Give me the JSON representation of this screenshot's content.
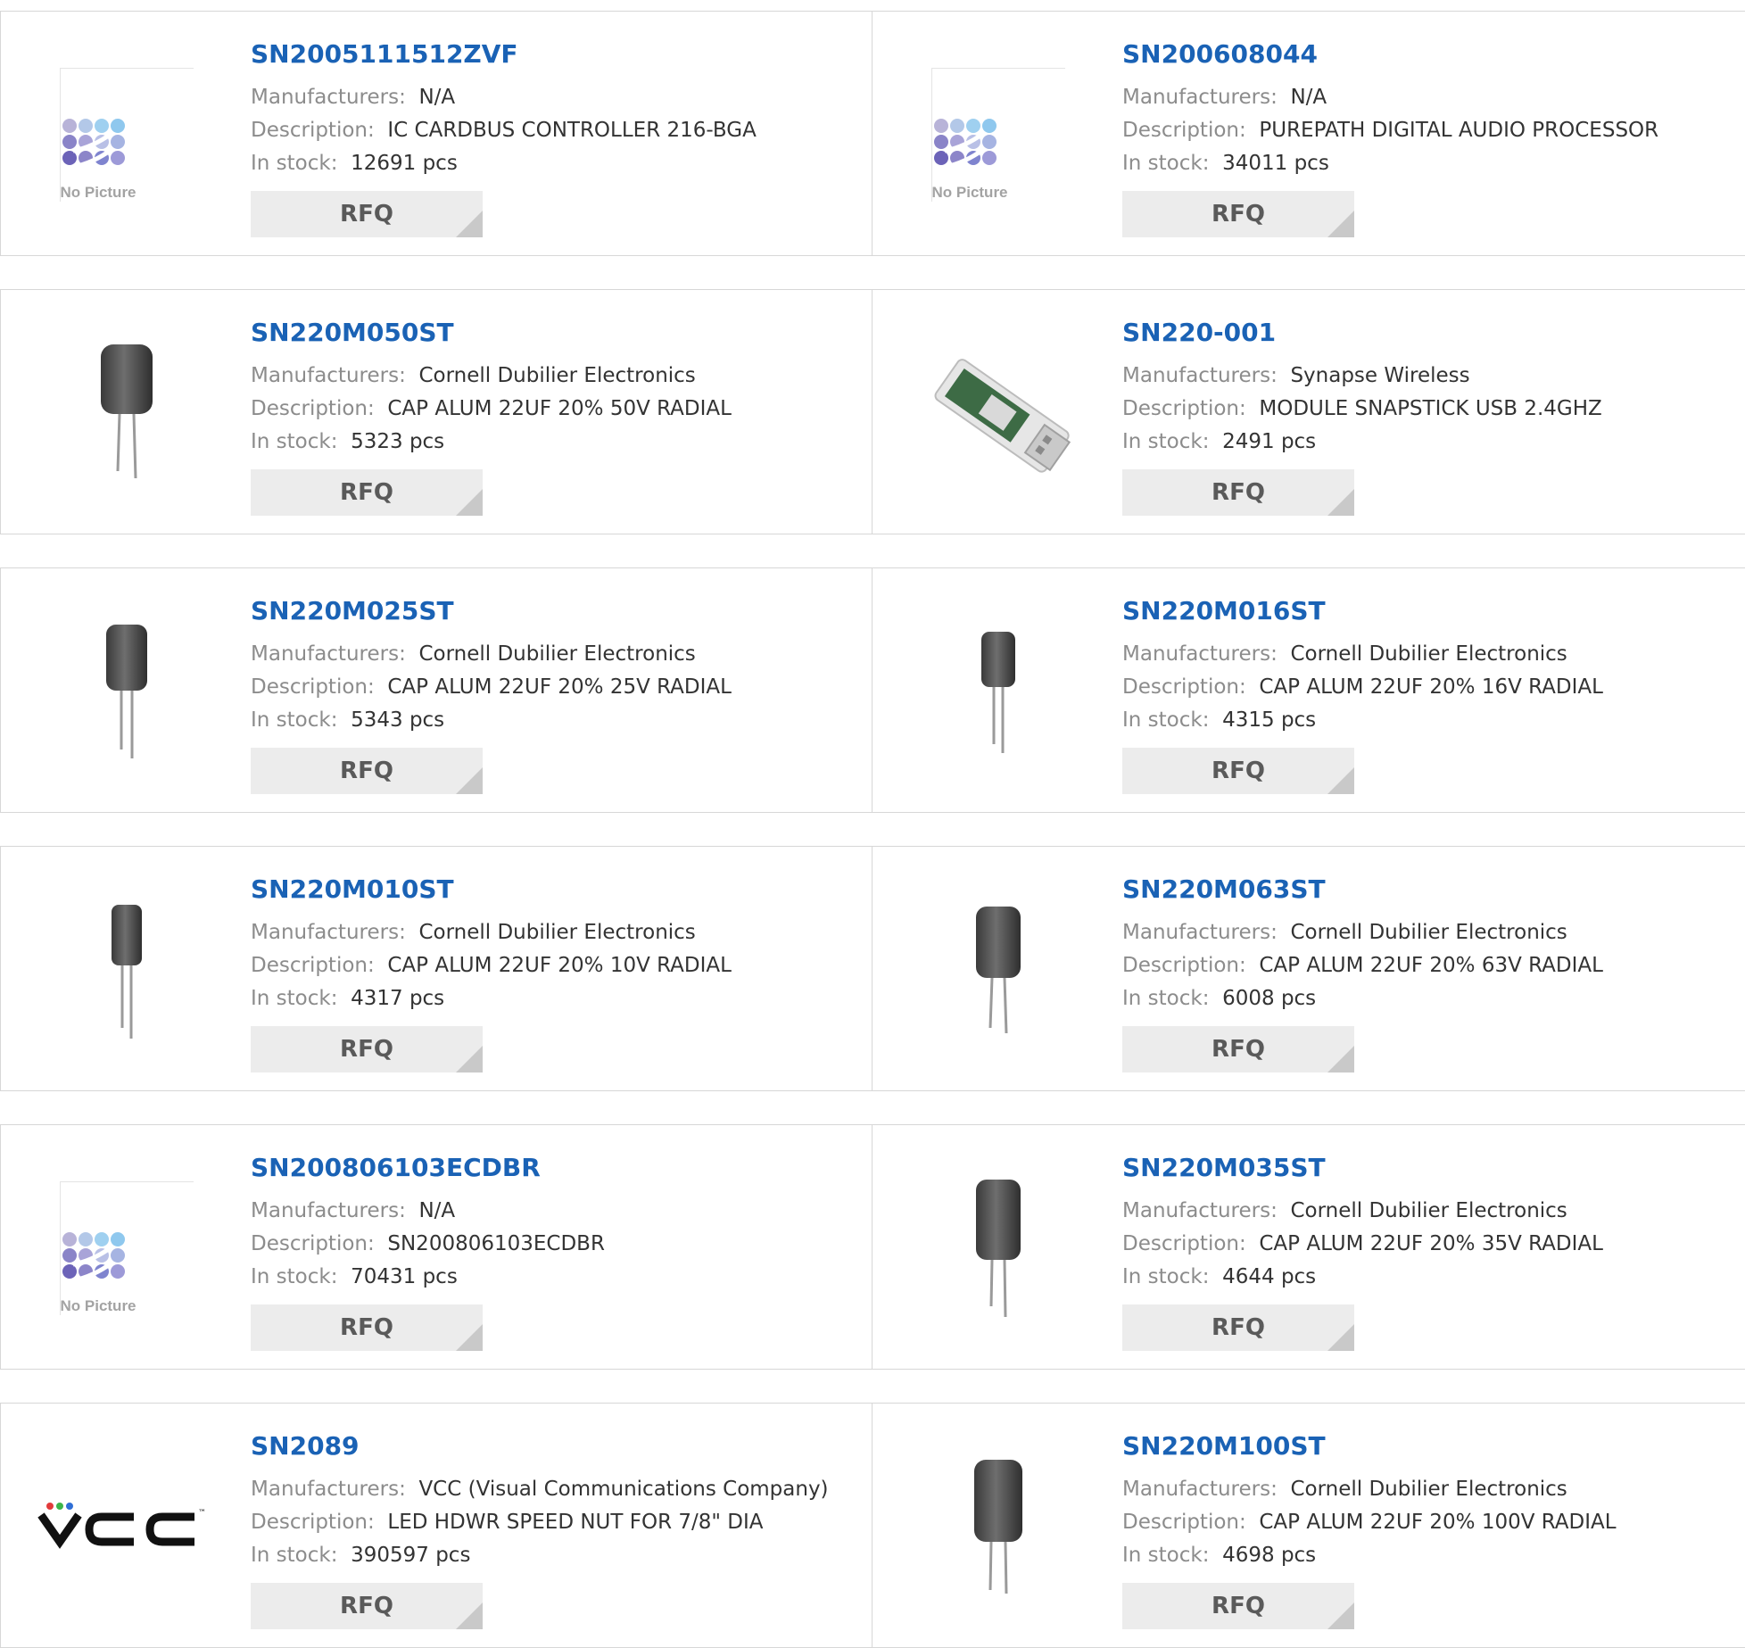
{
  "labels": {
    "manufacturers": "Manufacturers:",
    "description": "Description:",
    "in_stock": "In stock:",
    "rfq": "RFQ",
    "no_picture": "No Picture"
  },
  "products": [
    {
      "part": "SN2005111512ZVF",
      "manufacturer": "N/A",
      "description": "IC CARDBUS CONTROLLER 216-BGA",
      "stock": "12691 pcs",
      "image": "no-picture"
    },
    {
      "part": "SN200608044",
      "manufacturer": "N/A",
      "description": "PUREPATH DIGITAL AUDIO PROCESSOR",
      "stock": "34011 pcs",
      "image": "no-picture"
    },
    {
      "part": "SN220M050ST",
      "manufacturer": "Cornell Dubilier Electronics",
      "description": "CAP ALUM 22UF 20% 50V RADIAL",
      "stock": "5323 pcs",
      "image": "capacitor"
    },
    {
      "part": "SN220-001",
      "manufacturer": "Synapse Wireless",
      "description": "MODULE SNAPSTICK USB 2.4GHZ",
      "stock": "2491 pcs",
      "image": "usb-module"
    },
    {
      "part": "SN220M025ST",
      "manufacturer": "Cornell Dubilier Electronics",
      "description": "CAP ALUM 22UF 20% 25V RADIAL",
      "stock": "5343 pcs",
      "image": "capacitor"
    },
    {
      "part": "SN220M016ST",
      "manufacturer": "Cornell Dubilier Electronics",
      "description": "CAP ALUM 22UF 20% 16V RADIAL",
      "stock": "4315 pcs",
      "image": "capacitor"
    },
    {
      "part": "SN220M010ST",
      "manufacturer": "Cornell Dubilier Electronics",
      "description": "CAP ALUM 22UF 20% 10V RADIAL",
      "stock": "4317 pcs",
      "image": "capacitor"
    },
    {
      "part": "SN220M063ST",
      "manufacturer": "Cornell Dubilier Electronics",
      "description": "CAP ALUM 22UF 20% 63V RADIAL",
      "stock": "6008 pcs",
      "image": "capacitor"
    },
    {
      "part": "SN200806103ECDBR",
      "manufacturer": "N/A",
      "description": "SN200806103ECDBR",
      "stock": "70431 pcs",
      "image": "no-picture"
    },
    {
      "part": "SN220M035ST",
      "manufacturer": "Cornell Dubilier Electronics",
      "description": "CAP ALUM 22UF 20% 35V RADIAL",
      "stock": "4644 pcs",
      "image": "capacitor"
    },
    {
      "part": "SN2089",
      "manufacturer": "VCC (Visual Communications Company)",
      "description": "LED HDWR SPEED NUT FOR 7/8\" DIA",
      "stock": "390597 pcs",
      "image": "vcc-logo"
    },
    {
      "part": "SN220M100ST",
      "manufacturer": "Cornell Dubilier Electronics",
      "description": "CAP ALUM 22UF 20% 100V RADIAL",
      "stock": "4698 pcs",
      "image": "capacitor"
    }
  ]
}
